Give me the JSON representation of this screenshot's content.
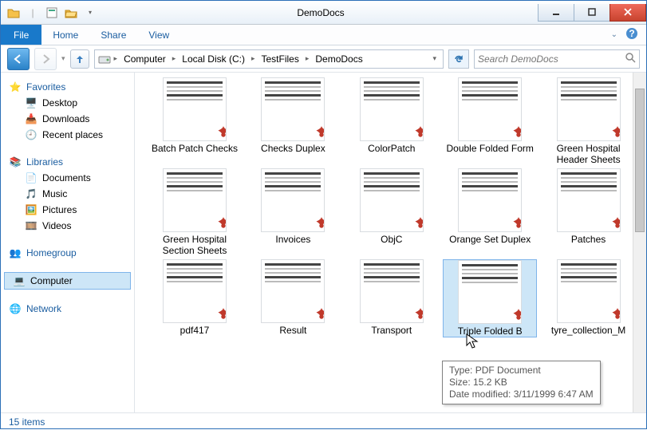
{
  "window": {
    "title": "DemoDocs"
  },
  "ribbon": {
    "file": "File",
    "tabs": [
      "Home",
      "Share",
      "View"
    ]
  },
  "breadcrumb": [
    "Computer",
    "Local Disk (C:)",
    "TestFiles",
    "DemoDocs"
  ],
  "search": {
    "placeholder": "Search DemoDocs"
  },
  "nav": {
    "favorites": {
      "label": "Favorites",
      "items": [
        "Desktop",
        "Downloads",
        "Recent places"
      ]
    },
    "libraries": {
      "label": "Libraries",
      "items": [
        "Documents",
        "Music",
        "Pictures",
        "Videos"
      ]
    },
    "homegroup": {
      "label": "Homegroup"
    },
    "computer": {
      "label": "Computer"
    },
    "network": {
      "label": "Network"
    }
  },
  "files": [
    {
      "name": "Batch Patch Checks"
    },
    {
      "name": "Checks Duplex"
    },
    {
      "name": "ColorPatch"
    },
    {
      "name": "Double Folded Form"
    },
    {
      "name": "Green Hospital Header Sheets"
    },
    {
      "name": "Green Hospital Section Sheets"
    },
    {
      "name": "Invoices"
    },
    {
      "name": "ObjC"
    },
    {
      "name": "Orange Set Duplex"
    },
    {
      "name": "Patches"
    },
    {
      "name": "pdf417"
    },
    {
      "name": "Result"
    },
    {
      "name": "Transport"
    },
    {
      "name": "Triple Folded B",
      "selected": true
    },
    {
      "name": "tyre_collection_M"
    }
  ],
  "tooltip": {
    "type_label": "Type:",
    "type_value": "PDF Document",
    "size_label": "Size:",
    "size_value": "15.2 KB",
    "date_label": "Date modified:",
    "date_value": "3/11/1999 6:47 AM"
  },
  "status": {
    "count": "15 items"
  }
}
